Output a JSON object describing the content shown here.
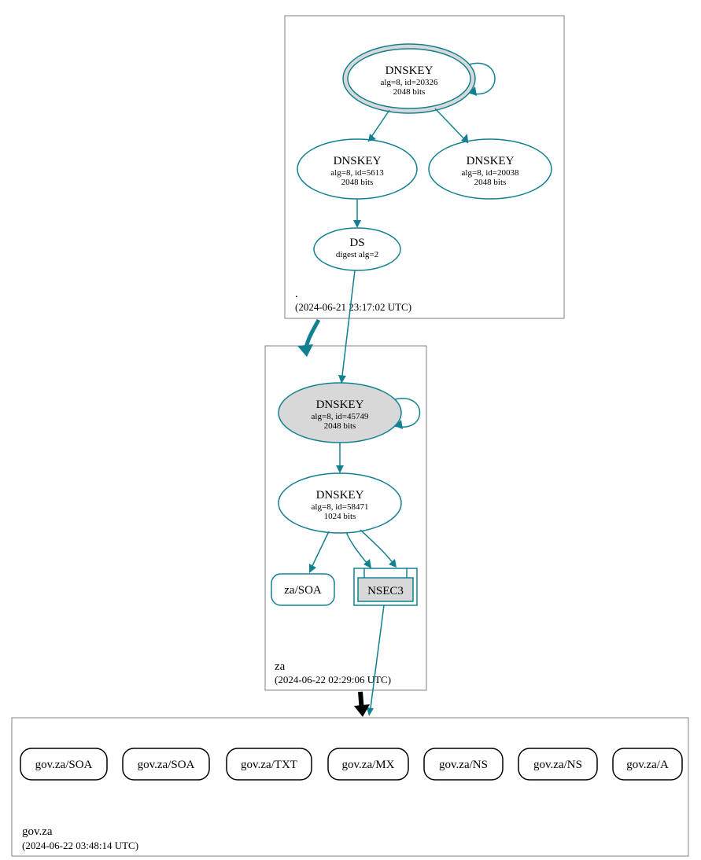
{
  "zones": {
    "root": {
      "label": ".",
      "timestamp": "(2024-06-21 23:17:02 UTC)"
    },
    "za": {
      "label": "za",
      "timestamp": "(2024-06-22 02:29:06 UTC)"
    },
    "govza": {
      "label": "gov.za",
      "timestamp": "(2024-06-22 03:48:14 UTC)"
    }
  },
  "nodes": {
    "root_ksk": {
      "title": "DNSKEY",
      "line1": "alg=8, id=20326",
      "line2": "2048 bits"
    },
    "root_zsk1": {
      "title": "DNSKEY",
      "line1": "alg=8, id=5613",
      "line2": "2048 bits"
    },
    "root_zsk2": {
      "title": "DNSKEY",
      "line1": "alg=8, id=20038",
      "line2": "2048 bits"
    },
    "root_ds": {
      "title": "DS",
      "line1": "digest alg=2"
    },
    "za_ksk": {
      "title": "DNSKEY",
      "line1": "alg=8, id=45749",
      "line2": "2048 bits"
    },
    "za_zsk": {
      "title": "DNSKEY",
      "line1": "alg=8, id=58471",
      "line2": "1024 bits"
    },
    "za_soa": {
      "title": "za/SOA"
    },
    "za_nsec3": {
      "title": "NSEC3"
    }
  },
  "rrsets": {
    "r0": "gov.za/SOA",
    "r1": "gov.za/SOA",
    "r2": "gov.za/TXT",
    "r3": "gov.za/MX",
    "r4": "gov.za/NS",
    "r5": "gov.za/NS",
    "r6": "gov.za/A"
  }
}
